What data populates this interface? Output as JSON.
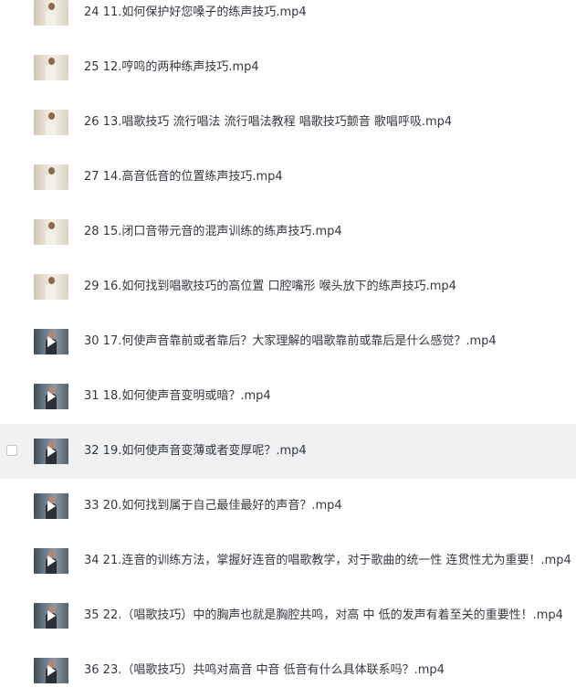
{
  "files": [
    {
      "name": "24 11.如何保护好您嗓子的练声技巧.mp4",
      "thumb": "light",
      "video": false
    },
    {
      "name": "25 12.哼鸣的两种练声技巧.mp4",
      "thumb": "light",
      "video": false
    },
    {
      "name": "26 13.唱歌技巧 流行唱法 流行唱法教程 唱歌技巧颤音 歌唱呼吸.mp4",
      "thumb": "light",
      "video": false
    },
    {
      "name": "27 14.高音低音的位置练声技巧.mp4",
      "thumb": "light",
      "video": false
    },
    {
      "name": "28 15.闭口音带元音的混声训练的练声技巧.mp4",
      "thumb": "light",
      "video": false
    },
    {
      "name": "29 16.如何找到唱歌技巧的高位置 口腔嘴形 喉头放下的练声技巧.mp4",
      "thumb": "light",
      "video": false
    },
    {
      "name": "30 17.何使声音靠前或者靠后？大家理解的唱歌靠前或靠后是什么感觉？.mp4",
      "thumb": "dark",
      "video": true
    },
    {
      "name": "31 18.如何使声音变明或暗？.mp4",
      "thumb": "dark",
      "video": true
    },
    {
      "name": "32 19.如何使声音变薄或者变厚呢？.mp4",
      "thumb": "dark",
      "video": true,
      "hover": true
    },
    {
      "name": "33 20.如何找到属于自己最佳最好的声音？.mp4",
      "thumb": "dark",
      "video": true
    },
    {
      "name": "34 21.连音的训练方法，掌握好连音的唱歌教学，对于歌曲的统一性 连贯性尤为重要！.mp4",
      "thumb": "dark",
      "video": true
    },
    {
      "name": "35 22.（唱歌技巧）中的胸声也就是胸腔共鸣，对高 中 低的发声有着至关的重要性！.mp4",
      "thumb": "dark",
      "video": true
    },
    {
      "name": "36 23.（唱歌技巧）共鸣对高音 中音 低音有什么具体联系吗？.mp4",
      "thumb": "dark",
      "video": true
    }
  ]
}
